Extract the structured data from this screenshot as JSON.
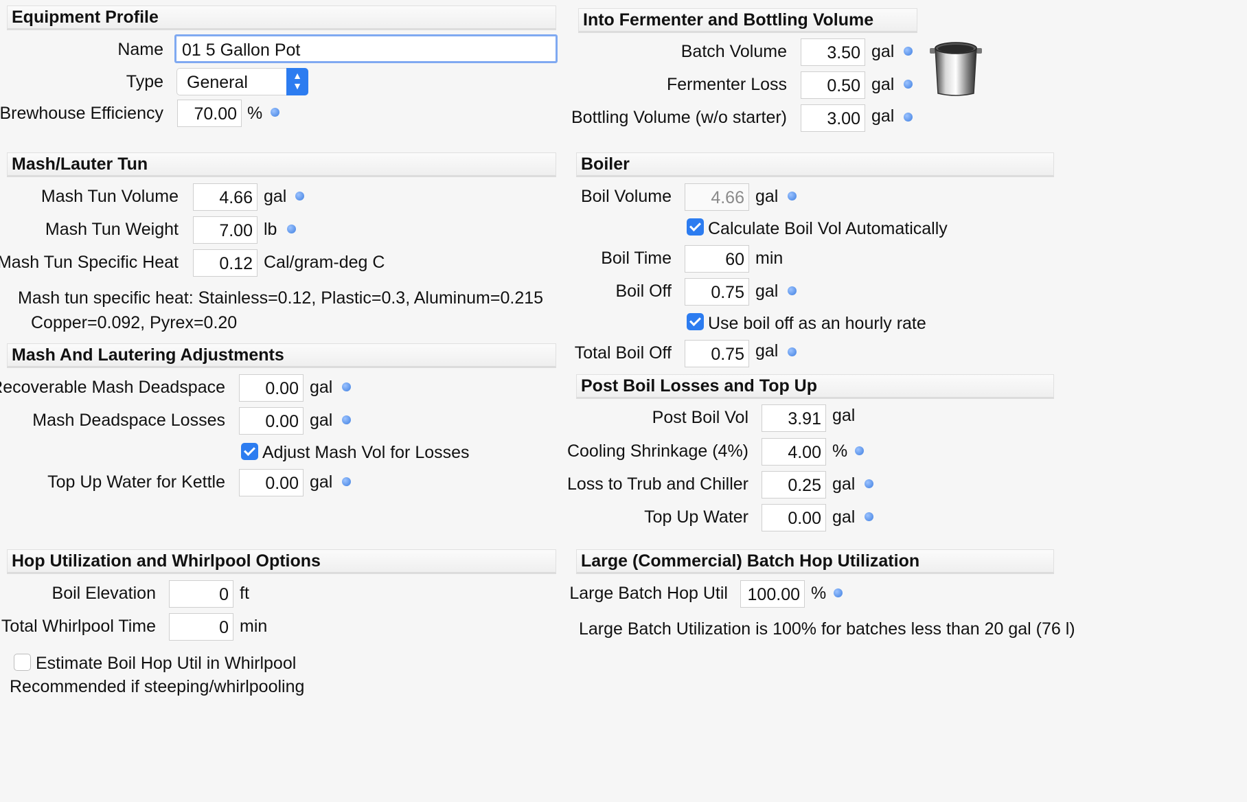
{
  "equipment": {
    "header": "Equipment Profile",
    "name_label": "Name",
    "name_value": "01 5 Gallon Pot",
    "type_label": "Type",
    "type_value": "General",
    "eff_label": "Brewhouse Efficiency",
    "eff_value": "70.00",
    "eff_unit": "%"
  },
  "fermenter": {
    "header": "Into Fermenter and Bottling Volume",
    "batch_label": "Batch Volume",
    "batch_value": "3.50",
    "batch_unit": "gal",
    "loss_label": "Fermenter Loss",
    "loss_value": "0.50",
    "loss_unit": "gal",
    "bottling_label": "Bottling Volume (w/o starter)",
    "bottling_value": "3.00",
    "bottling_unit": "gal"
  },
  "mash": {
    "header": "Mash/Lauter Tun",
    "volume_label": "Mash Tun Volume",
    "volume_value": "4.66",
    "volume_unit": "gal",
    "weight_label": "Mash Tun Weight",
    "weight_value": "7.00",
    "weight_unit": "lb",
    "heat_label": "Mash Tun Specific Heat",
    "heat_value": "0.12",
    "heat_unit": "Cal/gram-deg C",
    "note1": "Mash tun specific heat: Stainless=0.12, Plastic=0.3, Aluminum=0.215",
    "note2": "Copper=0.092, Pyrex=0.20"
  },
  "boiler": {
    "header": "Boiler",
    "volume_label": "Boil Volume",
    "volume_value": "4.66",
    "volume_unit": "gal",
    "calc_label": "Calculate Boil Vol Automatically",
    "time_label": "Boil Time",
    "time_value": "60",
    "time_unit": "min",
    "off_label": "Boil Off",
    "off_value": "0.75",
    "off_unit": "gal",
    "hourly_label": "Use boil off as an hourly rate",
    "total_label": "Total Boil Off",
    "total_value": "0.75",
    "total_unit": "gal"
  },
  "adjust": {
    "header": "Mash And Lautering Adjustments",
    "deadspace_label": "Recoverable Mash Deadspace",
    "deadspace_value": "0.00",
    "deadspace_unit": "gal",
    "losses_label": "Mash Deadspace Losses",
    "losses_value": "0.00",
    "losses_unit": "gal",
    "adjust_label": "Adjust Mash Vol for Losses",
    "topup_label": "Top Up Water for Kettle",
    "topup_value": "0.00",
    "topup_unit": "gal"
  },
  "postboil": {
    "header": "Post Boil Losses and Top Up",
    "vol_label": "Post Boil Vol",
    "vol_value": "3.91",
    "vol_unit": "gal",
    "cool_label": "Cooling Shrinkage (4%)",
    "cool_value": "4.00",
    "cool_unit": "%",
    "trub_label": "Loss to Trub and Chiller",
    "trub_value": "0.25",
    "trub_unit": "gal",
    "topup_label": "Top Up Water",
    "topup_value": "0.00",
    "topup_unit": "gal"
  },
  "hop": {
    "header": "Hop Utilization and Whirlpool Options",
    "elev_label": "Boil Elevation",
    "elev_value": "0",
    "elev_unit": "ft",
    "whirl_label": "Total Whirlpool Time",
    "whirl_value": "0",
    "whirl_unit": "min",
    "estimate_label": "Estimate Boil Hop Util in Whirlpool",
    "recommend": "Recommended if steeping/whirlpooling"
  },
  "large": {
    "header": "Large (Commercial) Batch Hop Utilization",
    "util_label": "Large Batch Hop Util",
    "util_value": "100.00",
    "util_unit": "%",
    "note": "Large Batch Utilization is 100% for batches less than 20 gal (76 l)"
  }
}
